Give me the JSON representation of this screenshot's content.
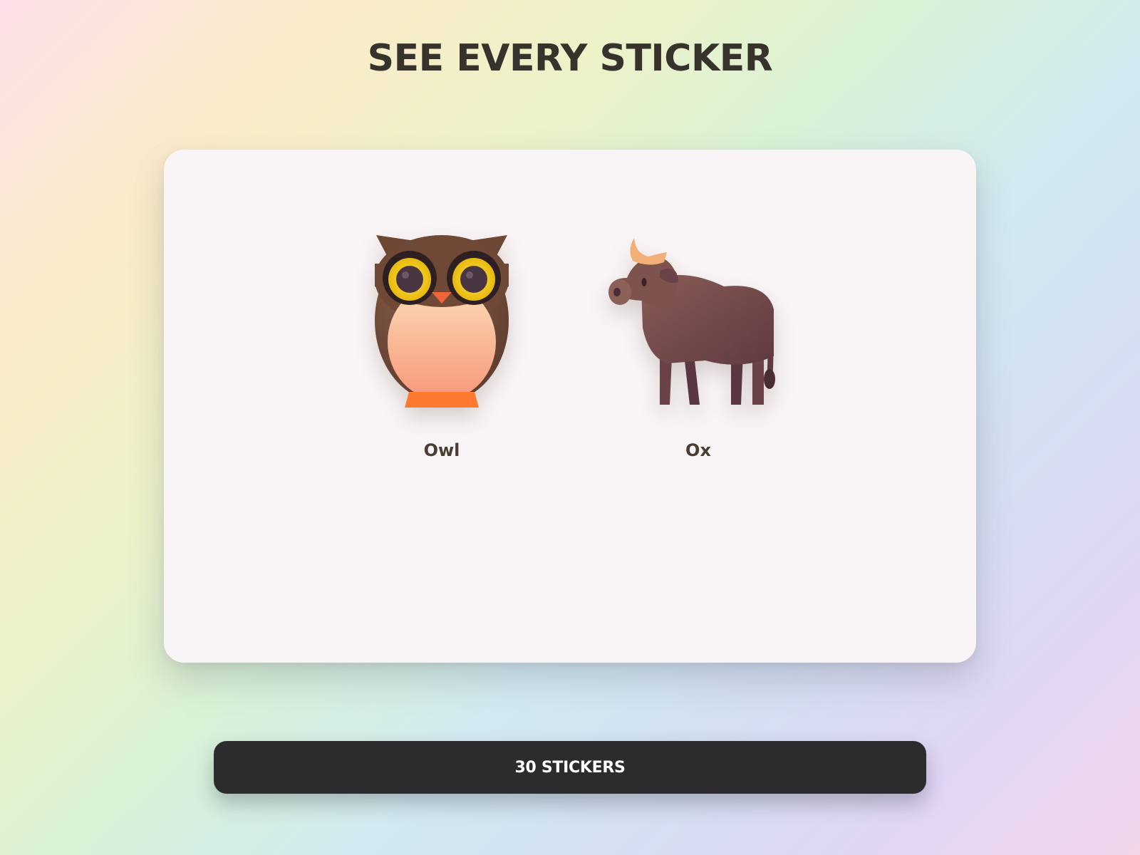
{
  "page": {
    "title": "SEE EVERY STICKER"
  },
  "stickers": [
    {
      "label": "Owl",
      "icon": "owl-icon"
    },
    {
      "label": "Ox",
      "icon": "ox-icon"
    }
  ],
  "footer": {
    "count_label": "30 STICKERS"
  },
  "colors": {
    "title_text": "#37322c",
    "card_background": "#f9f4f6",
    "button_background": "#2c2c2e",
    "button_text": "#ffffff",
    "label_text": "#4a3e34"
  }
}
